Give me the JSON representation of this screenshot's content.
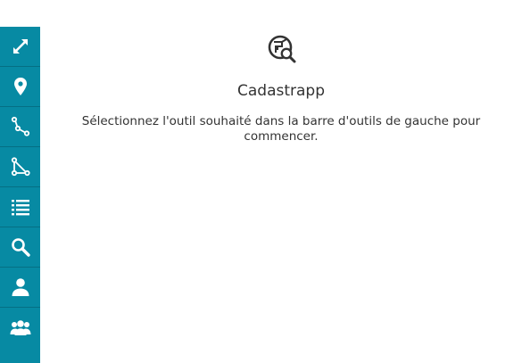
{
  "app": {
    "title": "Cadastrapp",
    "help_text": "Sélectionnez l'outil souhaité dans la barre d'outils de gauche pour commencer.",
    "logo_icon": "cadastre-search-icon"
  },
  "toolbar": {
    "background_color": "#078aa3",
    "items": [
      {
        "icon": "expand-icon"
      },
      {
        "icon": "map-marker-icon"
      },
      {
        "icon": "line-select-icon"
      },
      {
        "icon": "polygon-select-icon"
      },
      {
        "icon": "list-icon"
      },
      {
        "icon": "search-icon"
      },
      {
        "icon": "user-icon"
      },
      {
        "icon": "users-group-icon"
      }
    ]
  }
}
